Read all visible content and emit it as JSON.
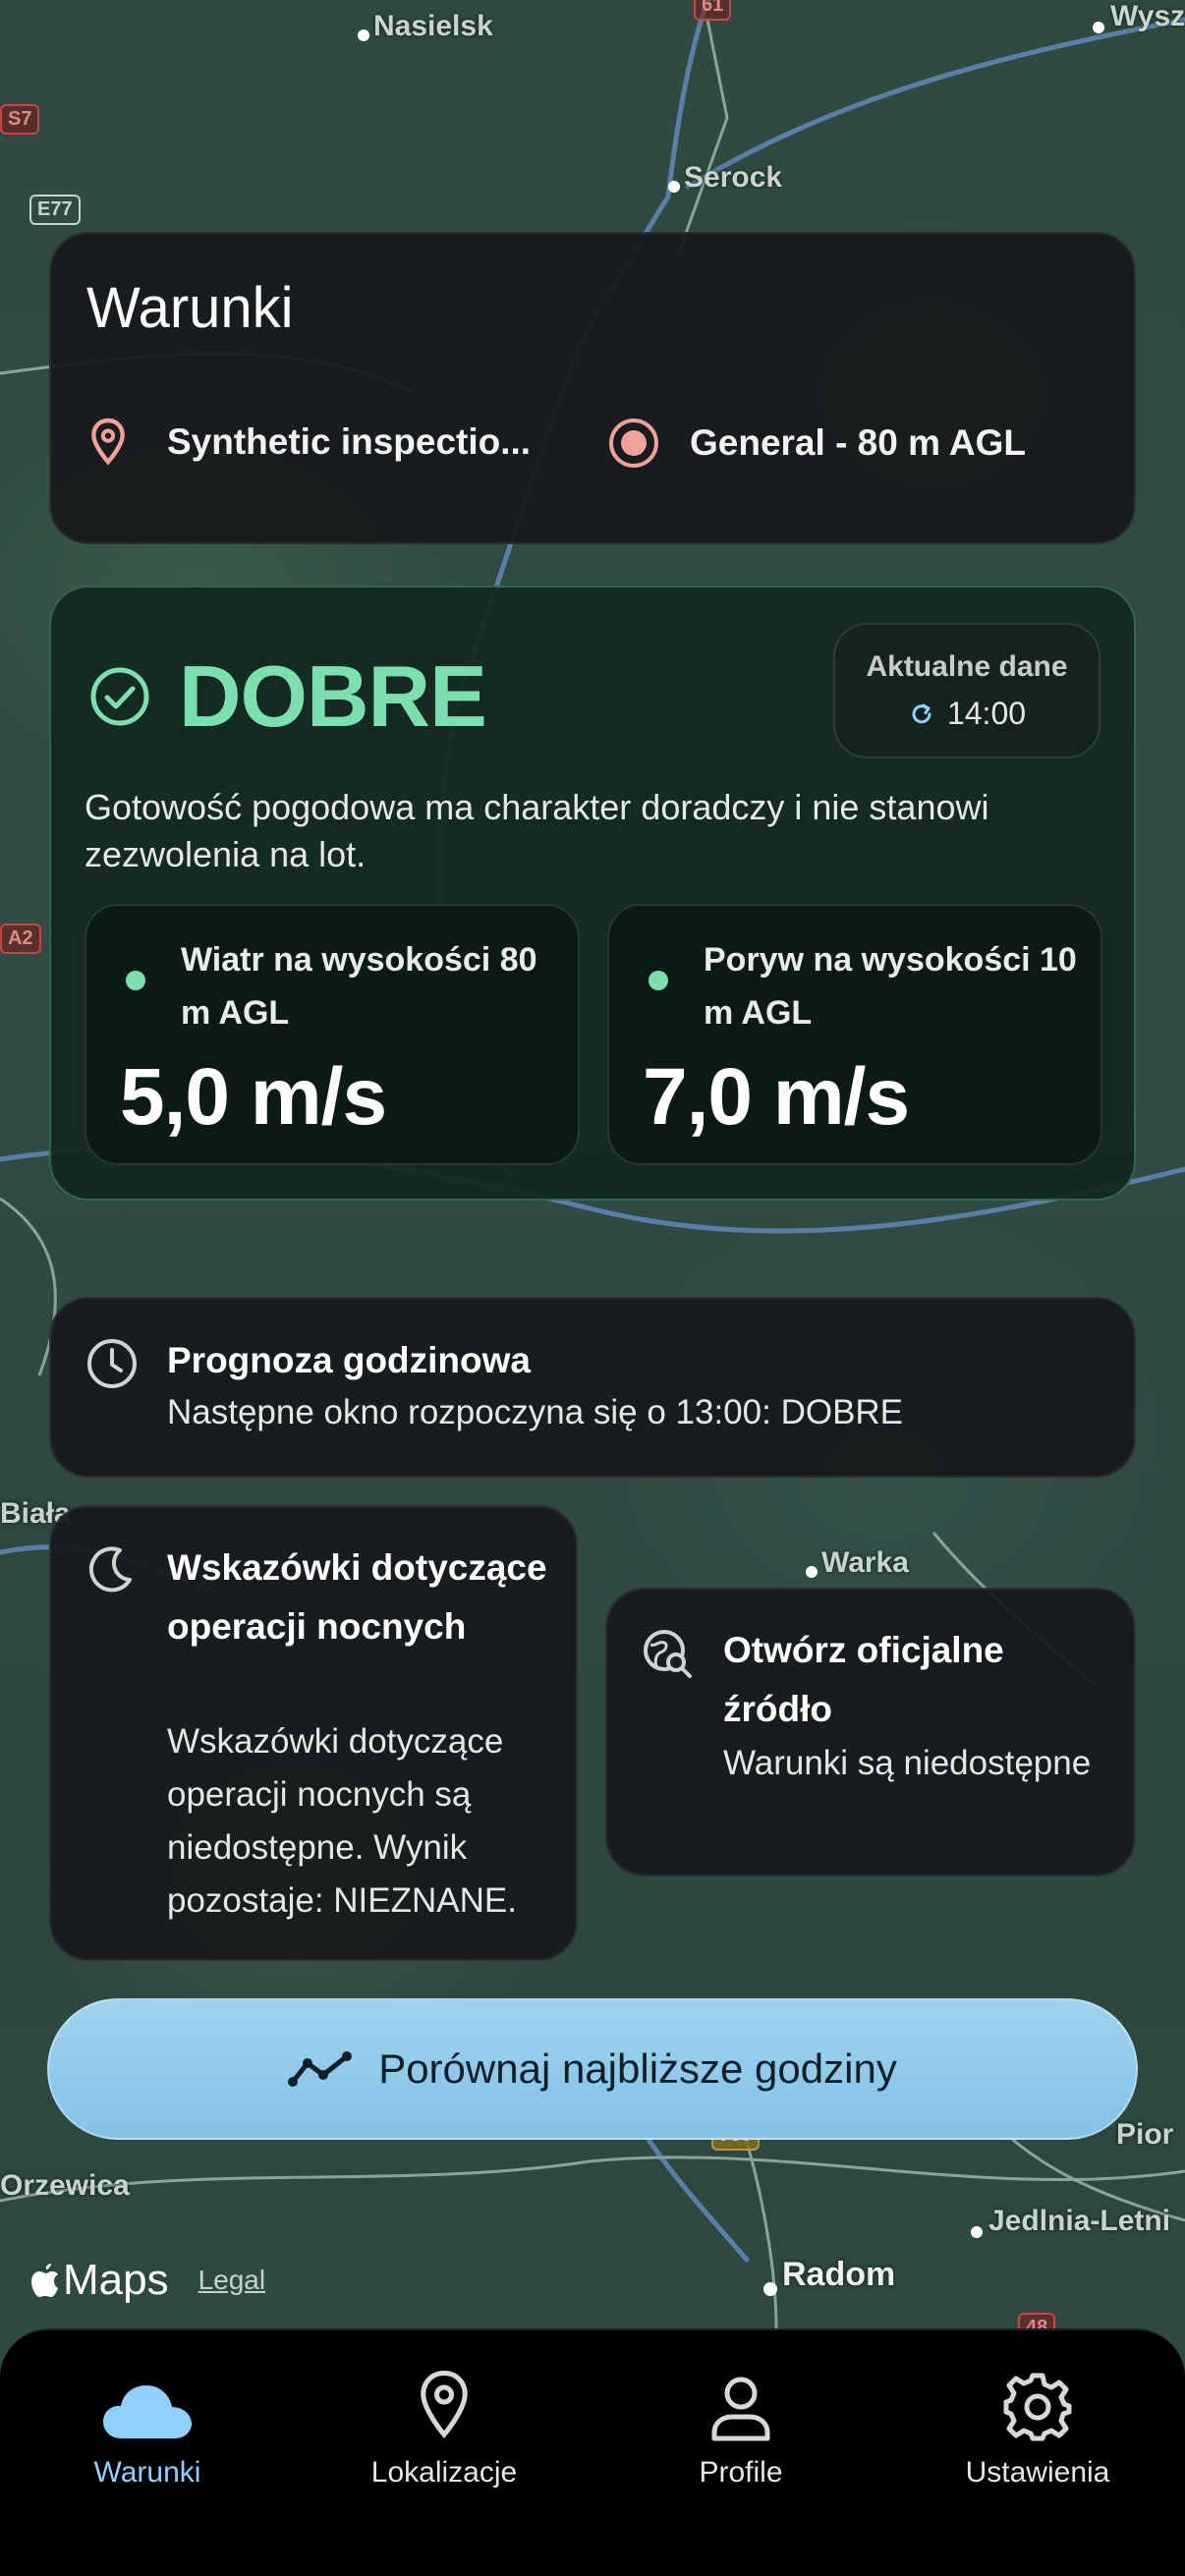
{
  "map": {
    "labels": [
      "Nasielsk",
      "Serock",
      "Wysz",
      "Warka",
      "Biała",
      "Orzewica",
      "Radom",
      "Jedlnia-Letni",
      "Pior"
    ],
    "road_signs": [
      "S7",
      "E77",
      "61",
      "A2",
      "735",
      "48"
    ],
    "attribution": {
      "brand": "Maps",
      "legal": "Legal"
    }
  },
  "header": {
    "title": "Warunki",
    "location": "Synthetic inspectio...",
    "profile": "General - 80 m AGL"
  },
  "status": {
    "label": "DOBRE",
    "color": "#7be0ad",
    "data_pill_title": "Aktualne dane",
    "data_time": "14:00",
    "advisory": "Gotowość pogodowa ma charakter doradczy i nie stanowi zezwolenia na lot.",
    "wind": {
      "label": "Wiatr na wysokości 80 m AGL",
      "value": "5,0 m/s"
    },
    "gust": {
      "label": "Poryw na wysokości 10 m AGL",
      "value": "7,0 m/s"
    }
  },
  "forecast": {
    "title": "Prognoza godzinowa",
    "subtitle": "Następne okno rozpoczyna się o 13:00: DOBRE"
  },
  "night": {
    "title": "Wskazówki dotyczące operacji nocnych",
    "subtitle": "Wskazówki dotyczące operacji nocnych są niedostępne. Wynik pozostaje: NIEZNANE."
  },
  "source": {
    "title": "Otwórz oficjalne źródło",
    "subtitle": "Warunki są niedostępne"
  },
  "compare_button": "Porównaj najbliższe godziny",
  "tabs": [
    {
      "label": "Warunki",
      "icon": "cloud-icon",
      "active": true
    },
    {
      "label": "Lokalizacje",
      "icon": "map-pin-icon",
      "active": false
    },
    {
      "label": "Profile",
      "icon": "person-icon",
      "active": false
    },
    {
      "label": "Ustawienia",
      "icon": "gear-icon",
      "active": false
    }
  ],
  "colors": {
    "accent": "#8fd0ff",
    "good": "#7be0ad",
    "pin": "#f0a29a"
  }
}
